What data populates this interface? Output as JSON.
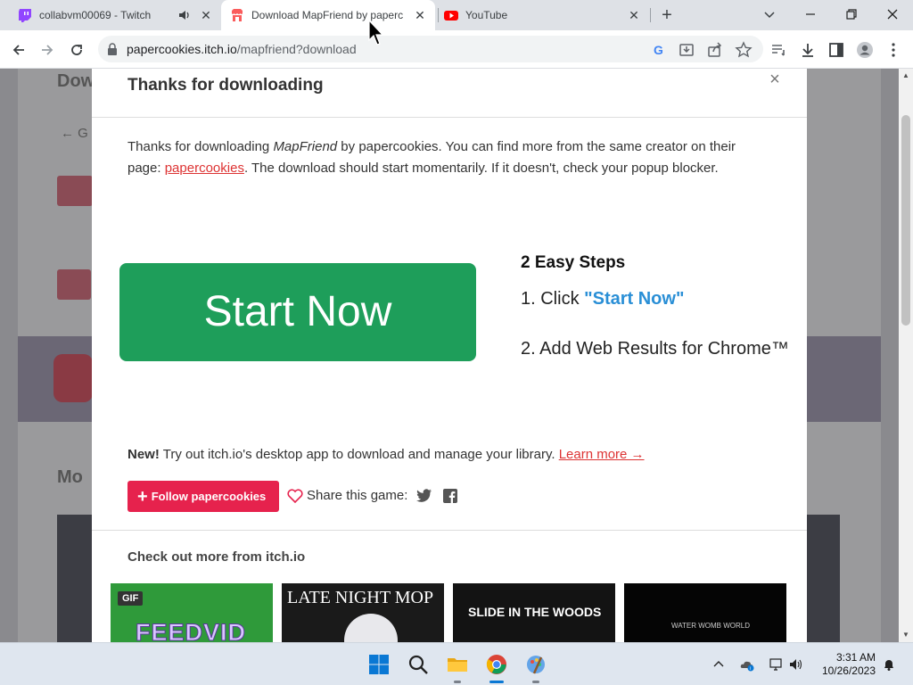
{
  "browser": {
    "tabs": [
      {
        "title": "collabvm00069 - Twitch",
        "icon": "twitch-icon",
        "audio": true
      },
      {
        "title": "Download MapFriend by papercookies",
        "icon": "itchio-icon",
        "active": true
      },
      {
        "title": "YouTube",
        "icon": "youtube-icon"
      }
    ],
    "url_host": "papercookies.itch.io",
    "url_path": "/mapfriend?download"
  },
  "modal": {
    "title": "Thanks for downloading",
    "text_pre": "Thanks for downloading ",
    "game_name": "MapFriend",
    "text_mid": " by papercookies. You can find more from the same creator on their page: ",
    "creator_link": "papercookies",
    "text_post": ". The download should start momentarily. If it doesn't, check your popup blocker.",
    "ad": {
      "button_label": "Start Now",
      "steps_title": "2 Easy Steps",
      "step1_prefix": "1. Click ",
      "step1_highlight": "\"Start Now\"",
      "step2": "2. Add Web Results for Chrome™"
    },
    "new_label": "New!",
    "new_text": " Try out itch.io's desktop app to download and manage your library. ",
    "learn_more": "Learn more →",
    "follow_button": "Follow papercookies",
    "share_label": "Share this game:",
    "more_title": "Check out more from itch.io",
    "thumbnails": [
      {
        "title": "FEEDVID",
        "badge": "GIF"
      },
      {
        "title": "LATE NIGHT MOP"
      },
      {
        "title": "SLIDE IN THE WOODS"
      },
      {
        "title": "WATER WOMB WORLD"
      }
    ]
  },
  "taskbar": {
    "time": "3:31 AM",
    "date": "10/26/2023"
  },
  "colors": {
    "start_button": "#1e9e5a",
    "follow_button": "#e6224d",
    "link": "#dd3333",
    "step_highlight": "#2a8fd6"
  }
}
